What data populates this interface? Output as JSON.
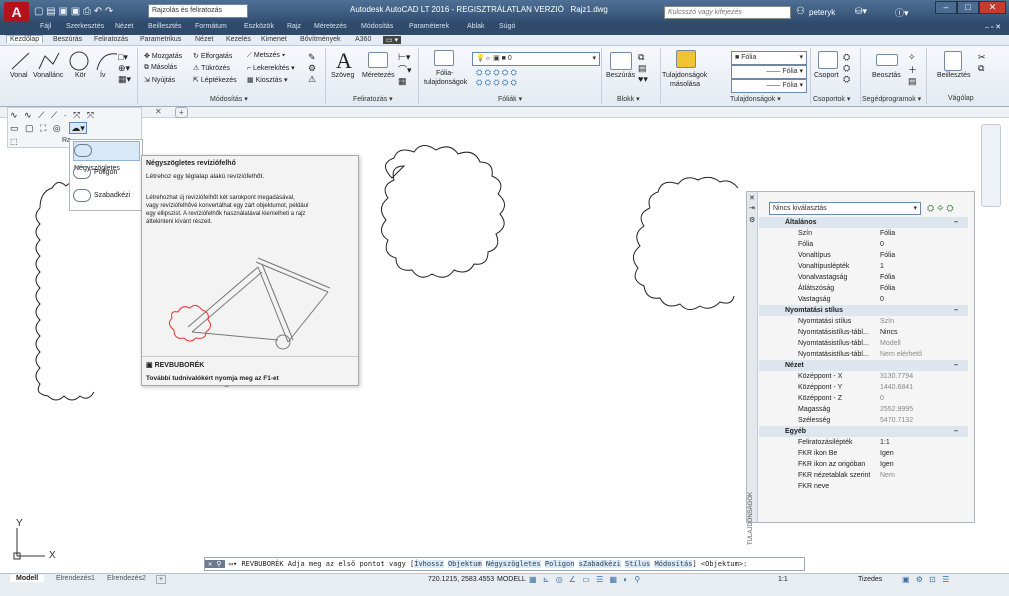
{
  "titlebar": {
    "app_title": "Autodesk AutoCAD LT 2016 - REGISZTRÁLATLAN VERZIÓ",
    "file_name": "Rajz1.dwg",
    "workspace": "Rajzolás és feliratozás",
    "search_placeholder": "Kulcsszó vagy kifejezés",
    "user": "peteryk",
    "logo": "A"
  },
  "menu": [
    "Fájl",
    "Szerkesztés",
    "Nézet",
    "Beillesztés",
    "Formátum",
    "Eszközök",
    "Rajz",
    "Méretezés",
    "Módosítás",
    "Paraméterek",
    "Ablak",
    "Súgó"
  ],
  "ribbon_tabs": [
    "Kezdőlap",
    "Beszúrás",
    "Feliratozás",
    "Parametrikus",
    "Nézet",
    "Kezelés",
    "Kimenet",
    "Bővítmények",
    "A360"
  ],
  "ribbon": {
    "draw": [
      "Vonal",
      "Vonallánc",
      "Kör",
      "Ív"
    ],
    "modify": [
      [
        "Mozgatás",
        "Elforgatás",
        "Metszés"
      ],
      [
        "Másolás",
        "Tükrözés",
        "Lekerekítés"
      ],
      [
        "Nyújtás",
        "Léptékezés",
        "Kiosztás"
      ]
    ],
    "modify_label": "Módosítás",
    "annot": [
      "Szöveg",
      "Méretezés"
    ],
    "annot_label": "Feliratozás",
    "layers_btn": [
      "Fólia-",
      "tulajdonságok"
    ],
    "layer_value": "0",
    "layers_label": "Fóliák",
    "block_btn": "Beszúrás",
    "block_label": "Blokk",
    "props_btn": [
      "Tulajdonságok",
      "másolása"
    ],
    "props_values": [
      "Fólia",
      "Fólia",
      "Fólia"
    ],
    "props_label": "Tulajdonságok",
    "groups_btn": "Csoport",
    "groups_label": "Csoportok",
    "util_btn": "Beosztás",
    "util_label": "Segédprogramok",
    "clip_btn": "Beillesztés",
    "clip_label": "Vágólap"
  },
  "left_panel_label": "Ra",
  "dropdown": [
    "Négyszögletes",
    "Poligon",
    "Szabadkézi"
  ],
  "tooltip": {
    "title": "Négyszögletes revíziófelhő",
    "short": "Létrehoz egy téglalap alakú revíziófelhőt.",
    "long": [
      "Létrehozhat új revíziófelhőt két sarokpont megadásával,",
      "vagy revíziófelhővé konvertálhat egy zárt objektumot, például",
      "egy ellipszist. A revíziófelhők használatával kiemelheti a rajz",
      "áttekinteni kívánt részeit."
    ],
    "command": "REVBUBORÉK",
    "footer": "További tudnivalókért nyomja meg az F1-et"
  },
  "properties": {
    "selection": "Nincs kiválasztás",
    "title_vertical": "TULAJDONSÁGOK",
    "sections": [
      {
        "name": "Általános",
        "rows": [
          [
            "Szín",
            "Fólia",
            false
          ],
          [
            "Fólia",
            "0",
            false
          ],
          [
            "Vonaltípus",
            "Fólia",
            false
          ],
          [
            "Vonaltípuslépték",
            "1",
            false
          ],
          [
            "Vonalvastagság",
            "Fólia",
            false
          ],
          [
            "Átlátszóság",
            "Fólia",
            false
          ],
          [
            "Vastagság",
            "0",
            false
          ]
        ]
      },
      {
        "name": "Nyomtatási stílus",
        "rows": [
          [
            "Nyomtatási stílus",
            "Szín",
            true
          ],
          [
            "Nyomtatásistílus-tábl...",
            "Nincs",
            false
          ],
          [
            "Nyomtatásistílus-tábl...",
            "Modell",
            true
          ],
          [
            "Nyomtatásistílus-tábl...",
            "Nem elérhető",
            true
          ]
        ]
      },
      {
        "name": "Nézet",
        "rows": [
          [
            "Középpont - X",
            "3130.7794",
            true
          ],
          [
            "Középpont - Y",
            "1440.6841",
            true
          ],
          [
            "Középpont - Z",
            "0",
            true
          ],
          [
            "Magasság",
            "2552.9995",
            true
          ],
          [
            "Szélesség",
            "5470.7132",
            true
          ]
        ]
      },
      {
        "name": "Egyéb",
        "rows": [
          [
            "Feliratozásilépték",
            "1:1",
            false
          ],
          [
            "FKR ikon Be",
            "Igen",
            false
          ],
          [
            "FKR ikon az origóban",
            "Igen",
            false
          ],
          [
            "FKR nézetablak szerint",
            "Nem",
            true
          ],
          [
            "FKR neve",
            "",
            false
          ]
        ]
      }
    ]
  },
  "command": {
    "prefix": "REVBUBORÉK Adja meg az első pontot vagy [",
    "options": [
      "Ívhossz",
      "Objektum",
      "Négyszögletes",
      "Poligon",
      "sZabadkézi",
      "Stílus",
      "Módosítás"
    ],
    "suffix": "] <Objektum>:"
  },
  "layout_tabs": [
    "Modell",
    "Elrendezés1",
    "Elrendezés2",
    "+"
  ],
  "status": {
    "coords": "720.1215, 2583.4553",
    "mode": "MODELL",
    "scale": "1:1",
    "workspace": "Tizedes"
  },
  "ucs": {
    "x": "X",
    "y": "Y"
  }
}
